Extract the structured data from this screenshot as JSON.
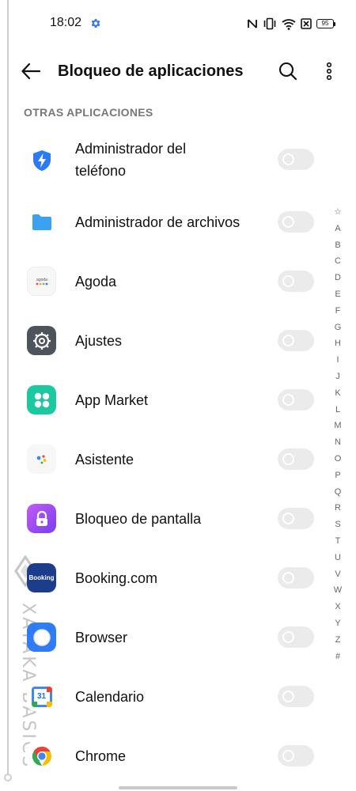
{
  "status_bar": {
    "time": "18:02",
    "battery": "95",
    "icons": [
      "gear-icon",
      "nfc-icon",
      "vibrate-icon",
      "wifi-icon",
      "no-sim-icon",
      "battery-icon"
    ]
  },
  "header": {
    "title": "Bloqueo de aplicaciones",
    "icons": [
      "back-arrow-icon",
      "search-icon",
      "more-vertical-icon"
    ]
  },
  "section_title": "OTRAS APLICACIONES",
  "apps": [
    {
      "name": "Administrador del",
      "name2": "teléfono",
      "icon": "phone-manager-icon",
      "locked": false
    },
    {
      "name": "Administrador de archivos",
      "icon": "folder-icon",
      "locked": false
    },
    {
      "name": "Agoda",
      "icon": "agoda-icon",
      "locked": false
    },
    {
      "name": "Ajustes",
      "icon": "settings-gear-icon",
      "locked": false
    },
    {
      "name": "App Market",
      "icon": "app-market-icon",
      "locked": false
    },
    {
      "name": "Asistente",
      "icon": "assistant-icon",
      "locked": false
    },
    {
      "name": "Bloqueo de pantalla",
      "icon": "lock-icon",
      "locked": false
    },
    {
      "name": "Booking.com",
      "icon": "booking-icon",
      "booking_text": "Booking",
      "locked": false
    },
    {
      "name": "Browser",
      "icon": "browser-icon",
      "locked": false
    },
    {
      "name": "Calendario",
      "icon": "calendar-icon",
      "calendar_day": "31",
      "locked": false
    },
    {
      "name": "Chrome",
      "icon": "chrome-icon",
      "locked": false
    }
  ],
  "alphabet_index": [
    "☆",
    "A",
    "B",
    "C",
    "D",
    "E",
    "F",
    "G",
    "H",
    "I",
    "J",
    "K",
    "L",
    "M",
    "N",
    "O",
    "P",
    "Q",
    "R",
    "S",
    "T",
    "U",
    "V",
    "W",
    "X",
    "Y",
    "Z",
    "#"
  ],
  "watermark": "XATAKA BASICS",
  "colors": {
    "accent": "#3478f6",
    "toggle_off": "#ebebeb",
    "section_text": "#777777"
  }
}
